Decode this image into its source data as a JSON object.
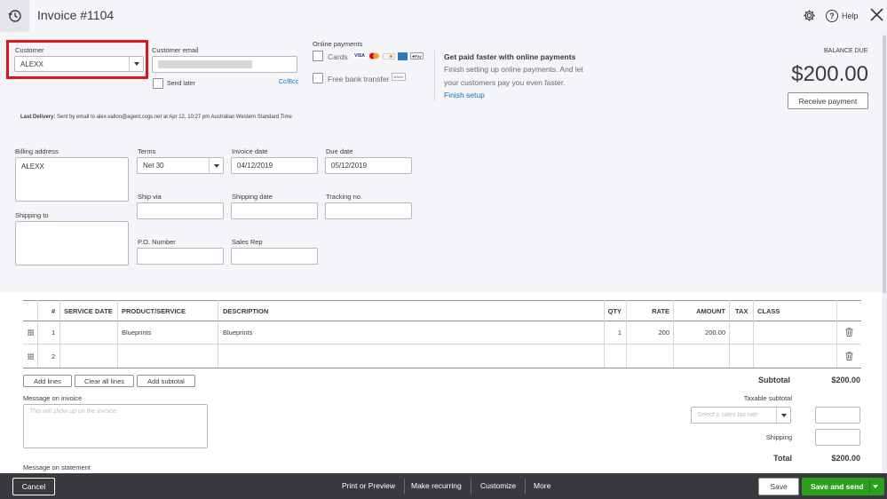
{
  "header": {
    "title": "Invoice #1104",
    "help_label": "Help"
  },
  "customer": {
    "label": "Customer",
    "value": "ALEXX",
    "email_label": "Customer email",
    "send_later_label": "Send later",
    "cc_bcc_label": "Cc/Bcc"
  },
  "online_payments": {
    "label": "Online payments",
    "cards_label": "Cards",
    "bank_label": "Free bank transfer",
    "promo_title": "Get paid faster with online payments",
    "promo_text_1": "Finish setting up online payments. And let",
    "promo_text_2": "your customers pay you even faster.",
    "finish_setup": "Finish setup",
    "card_icons": [
      "VISA",
      "mastercard",
      "discover",
      "amex",
      "Apple Pay"
    ],
    "bank_icon": "BANK"
  },
  "balance": {
    "label": "BALANCE DUE",
    "amount": "$200.00",
    "receive_payment": "Receive payment"
  },
  "last_delivery": {
    "label": "Last Delivery:",
    "text": "Sent by email to alex.vallon@agent.cvgs.net at Apr 12, 10:27 pm Australian Western Standard Time"
  },
  "form": {
    "billing_label": "Billing address",
    "billing_value": "ALEXX",
    "shipping_to_label": "Shipping to",
    "terms_label": "Terms",
    "terms_value": "Net 30",
    "invoice_date_label": "Invoice date",
    "invoice_date_value": "04/12/2019",
    "due_date_label": "Due date",
    "due_date_value": "05/12/2019",
    "ship_via_label": "Ship via",
    "shipping_date_label": "Shipping date",
    "tracking_label": "Tracking no.",
    "po_label": "P.O. Number",
    "sales_rep_label": "Sales Rep"
  },
  "table": {
    "headers": {
      "num": "#",
      "service_date": "SERVICE DATE",
      "product": "PRODUCT/SERVICE",
      "description": "DESCRIPTION",
      "qty": "QTY",
      "rate": "RATE",
      "amount": "AMOUNT",
      "tax": "TAX",
      "class": "CLASS"
    },
    "rows": [
      {
        "num": "1",
        "product": "Blueprints",
        "description": "Blueprints",
        "qty": "1",
        "rate": "200",
        "amount": "200.00"
      },
      {
        "num": "2",
        "product": "",
        "description": "",
        "qty": "",
        "rate": "",
        "amount": ""
      }
    ]
  },
  "table_actions": {
    "add_lines": "Add lines",
    "clear_all": "Clear all lines",
    "add_subtotal": "Add subtotal"
  },
  "messages": {
    "invoice_label": "Message on invoice",
    "invoice_placeholder": "This will show up on the invoice.",
    "statement_label": "Message on statement"
  },
  "totals": {
    "subtotal_label": "Subtotal",
    "subtotal_value": "$200.00",
    "taxable_label": "Taxable subtotal",
    "tax_placeholder": "Select a sales tax rate",
    "shipping_label": "Shipping",
    "total_label": "Total",
    "total_value": "$200.00"
  },
  "footer": {
    "cancel": "Cancel",
    "print": "Print or Preview",
    "recurring": "Make recurring",
    "customize": "Customize",
    "more": "More",
    "save": "Save",
    "save_send": "Save and send"
  },
  "colors": {
    "accent_green": "#2ca01c",
    "highlight_red": "#e8101b",
    "link_blue": "#0077c5",
    "footer_bg": "#393a3d"
  }
}
